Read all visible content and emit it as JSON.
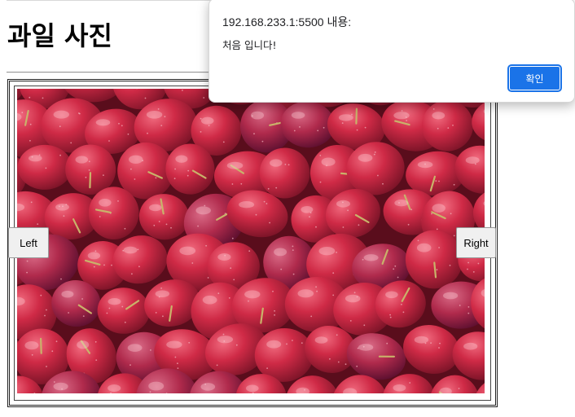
{
  "page": {
    "title": "과일 사진"
  },
  "gallery": {
    "image_alt": "fruit photo",
    "prev_label": "Left",
    "next_label": "Right"
  },
  "alert": {
    "origin": "192.168.233.1:5500 내용:",
    "message": "처음 입니다!",
    "ok_label": "확인"
  },
  "colors": {
    "accent": "#1a73e8",
    "fruit_primary": "#c8243f",
    "fruit_dark": "#7c1428"
  }
}
